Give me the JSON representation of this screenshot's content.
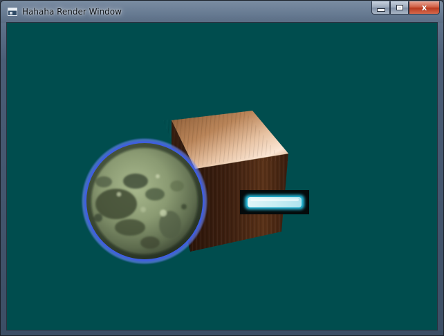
{
  "window": {
    "title": "Hahaha Render Window",
    "icon": "app-window-icon",
    "controls": {
      "minimize_icon": "minimize-icon",
      "maximize_icon": "maximize-icon",
      "close_icon": "close-icon",
      "close_glyph": "x"
    }
  },
  "scene": {
    "background_color": "#004d4e",
    "objects": [
      "moon-sphere",
      "wooden-cube",
      "glowing-panel"
    ]
  }
}
